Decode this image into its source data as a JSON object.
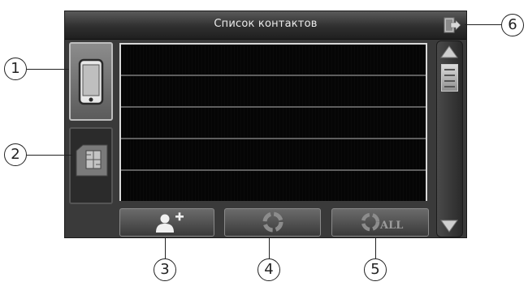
{
  "titlebar": {
    "title": "Список контактов"
  },
  "icons": {
    "exit": "exit-icon",
    "phone": "phone-icon",
    "sim": "sim-card-icon",
    "add_contact": "add-contact-icon",
    "delete": "recycle-icon",
    "delete_all": "recycle-all-icon"
  },
  "buttons": {
    "delete_all_label": "ALL"
  },
  "contacts": {
    "rows": 5
  },
  "callouts": [
    "1",
    "2",
    "3",
    "4",
    "5",
    "6"
  ]
}
